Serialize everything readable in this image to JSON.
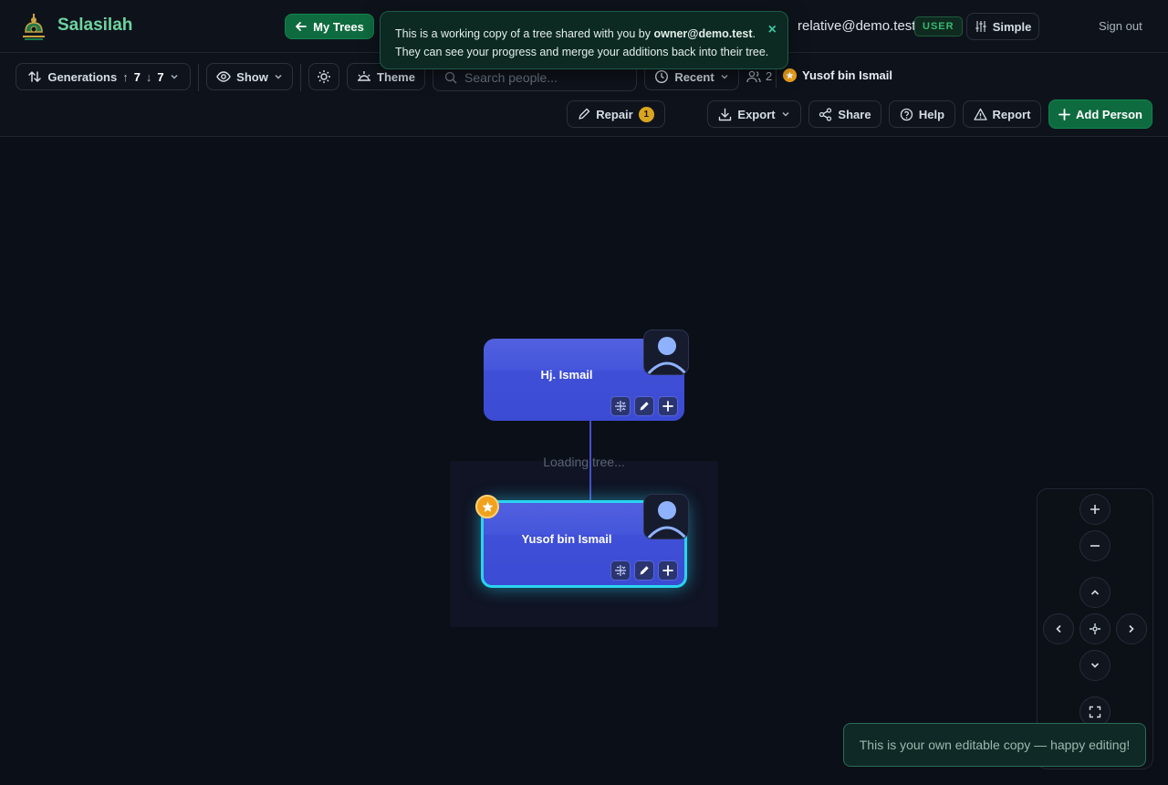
{
  "app": {
    "brand": "Salasilah"
  },
  "header": {
    "my_trees": "My Trees",
    "email": "relative@demo.test",
    "role": "USER",
    "mode": "Simple",
    "sign_out": "Sign out"
  },
  "banner": {
    "line1_prefix": "This is a working copy of a tree shared with you by ",
    "owner": "owner@demo.test",
    "line1_suffix": ".",
    "line2": "They can see your progress and merge your additions back into their tree."
  },
  "toolbar": {
    "generations_label": "Generations",
    "gen_up": "7",
    "gen_down": "7",
    "show": "Show",
    "theme": "Theme",
    "search_placeholder": "Search people...",
    "recent": "Recent",
    "people_count": "2",
    "focus_person": "Yusof bin Ismail",
    "repair": "Repair",
    "repair_count": "1",
    "export": "Export",
    "share": "Share",
    "help": "Help",
    "report": "Report",
    "add_person": "Add Person"
  },
  "canvas": {
    "loading": "Loading tree...",
    "people": [
      {
        "name": "Hj. Ismail",
        "selected": false
      },
      {
        "name": "Yusof bin Ismail",
        "selected": true
      }
    ]
  },
  "toast": "This is your own editable copy — happy editing!",
  "colors": {
    "accent_green": "#0e6b3f",
    "card_blue": "#4656dc",
    "selected_cyan": "#2ad4f0",
    "star": "#f0a21c"
  }
}
